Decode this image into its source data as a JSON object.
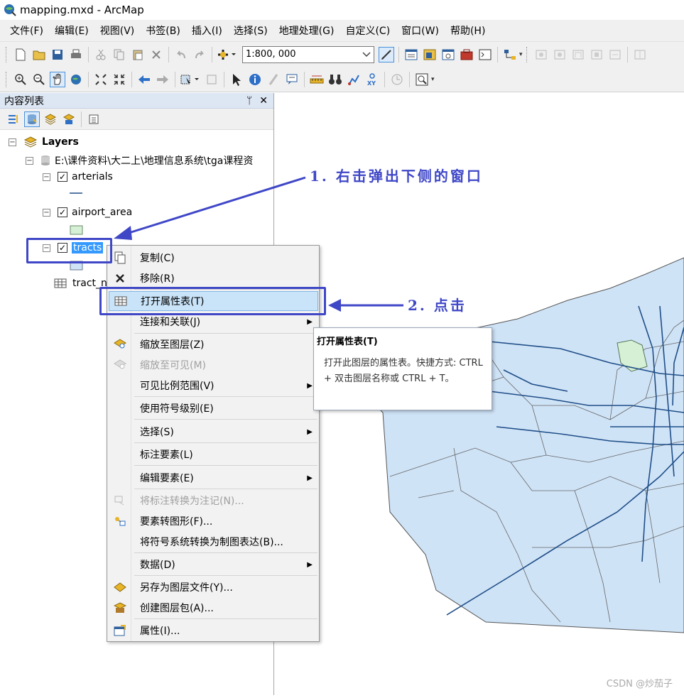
{
  "app": {
    "title": "mapping.mxd - ArcMap"
  },
  "menu": [
    "文件(F)",
    "编辑(E)",
    "视图(V)",
    "书签(B)",
    "插入(I)",
    "选择(S)",
    "地理处理(G)",
    "自定义(C)",
    "窗口(W)",
    "帮助(H)"
  ],
  "toolbar": {
    "scale": "1:800, 000"
  },
  "toc": {
    "title": "内容列表",
    "pin": "ᛘ",
    "close": "✕",
    "root": "Layers",
    "path": "E:\\课件资料\\大二上\\地理信息系统\\tga课程资",
    "layers": [
      "arterials",
      "airport_area",
      "tracts"
    ],
    "table": "tract_n"
  },
  "context_menu": {
    "items": [
      "复制(C)",
      "移除(R)",
      "打开属性表(T)",
      "连接和关联(J)",
      "缩放至图层(Z)",
      "缩放至可见(M)",
      "可见比例范围(V)",
      "使用符号级别(E)",
      "选择(S)",
      "标注要素(L)",
      "编辑要素(E)",
      "将标注转换为注记(N)...",
      "要素转图形(F)...",
      "将符号系统转换为制图表达(B)...",
      "数据(D)",
      "另存为图层文件(Y)...",
      "创建图层包(A)...",
      "属性(I)..."
    ]
  },
  "tooltip": {
    "title": "打开属性表(T)",
    "body": "打开此图层的属性表。快捷方式: CTRL + 双击图层名称或 CTRL + T。"
  },
  "annotations": {
    "step1": "1. 右击弹出下侧的窗口",
    "step2": "2. 点击"
  },
  "watermark": "CSDN @炒茄子",
  "colors": {
    "annotation": "#3f47c7",
    "tracts_fill": "#cfe3f7",
    "airport_fill": "#d5f0d5",
    "arterial_line": "#1f4e87",
    "highlight": "#3399ff"
  }
}
